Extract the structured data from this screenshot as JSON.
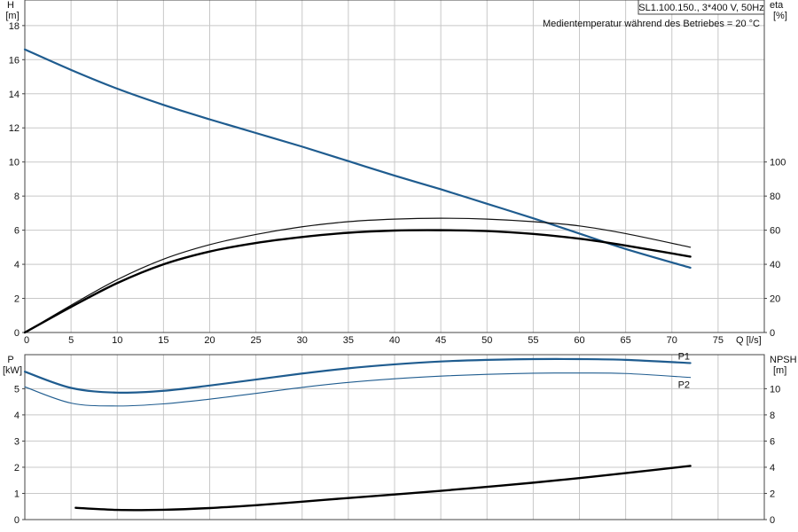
{
  "chart_data": [
    {
      "type": "line",
      "title": "SL1.100.150., 3*400 V, 50Hz",
      "subtitle": "Medientemperatur während des Betriebes = 20 °C",
      "xlabel": "Q [l/s]",
      "ylabel_left": [
        "H",
        "[m]"
      ],
      "ylabel_right": [
        "eta",
        "[%]"
      ],
      "xlim": [
        0,
        80
      ],
      "ylim_left": [
        0,
        19.5
      ],
      "ylim_right": [
        0,
        195
      ],
      "x_ticks": [
        "0",
        "5",
        "10",
        "15",
        "20",
        "25",
        "30",
        "35",
        "40",
        "45",
        "50",
        "55",
        "60",
        "65",
        "70",
        "75"
      ],
      "y_left_ticks": [
        "0",
        "2",
        "4",
        "6",
        "8",
        "10",
        "12",
        "14",
        "16",
        "18"
      ],
      "y_right_ticks": [
        "0",
        "20",
        "40",
        "60",
        "80",
        "100"
      ],
      "grid": true,
      "series": [
        {
          "axis": "left",
          "color": "#1f5c8f",
          "width": 2.2,
          "x": [
            0,
            5,
            10,
            15,
            20,
            25,
            30,
            35,
            40,
            45,
            50,
            55,
            60,
            65,
            72
          ],
          "y": [
            16.6,
            15.4,
            14.3,
            13.35,
            12.5,
            11.7,
            10.9,
            10.05,
            9.2,
            8.4,
            7.55,
            6.7,
            5.8,
            4.9,
            3.8
          ]
        },
        {
          "axis": "right",
          "color": "#111111",
          "width": 1.2,
          "x": [
            0,
            5,
            10,
            15,
            20,
            25,
            30,
            35,
            40,
            45,
            50,
            55,
            60,
            65,
            72
          ],
          "y": [
            0,
            16,
            31,
            43,
            51.5,
            57.5,
            62,
            65,
            66.5,
            67,
            66.5,
            65,
            62.5,
            58,
            50
          ]
        },
        {
          "axis": "right",
          "color": "#000000",
          "width": 2.4,
          "x": [
            0,
            5,
            10,
            15,
            20,
            25,
            30,
            35,
            40,
            45,
            50,
            55,
            60,
            65,
            72
          ],
          "y": [
            0,
            15,
            29,
            40,
            47.5,
            52.5,
            56,
            58.5,
            59.8,
            60,
            59.5,
            57.8,
            55,
            51,
            44.5
          ]
        }
      ]
    },
    {
      "type": "line",
      "ylabel_left": [
        "P",
        "[kW]"
      ],
      "ylabel_right": [
        "NPSH",
        "[m]"
      ],
      "xlim": [
        0,
        80
      ],
      "ylim_left": [
        0,
        6.3
      ],
      "ylim_right": [
        0,
        12.6
      ],
      "y_left_ticks": [
        "0",
        "1",
        "2",
        "3",
        "4",
        "5"
      ],
      "y_right_ticks": [
        "0",
        "2",
        "4",
        "6",
        "8",
        "10"
      ],
      "grid": true,
      "series": [
        {
          "name": "P1",
          "axis": "left",
          "color": "#1f5c8f",
          "width": 2.2,
          "x": [
            0,
            5,
            10,
            15,
            20,
            25,
            30,
            35,
            40,
            45,
            50,
            55,
            60,
            65,
            72
          ],
          "y": [
            5.65,
            5.03,
            4.85,
            4.92,
            5.12,
            5.35,
            5.58,
            5.78,
            5.93,
            6.04,
            6.1,
            6.13,
            6.13,
            6.1,
            5.98
          ]
        },
        {
          "name": "P2",
          "axis": "left",
          "color": "#1f5c8f",
          "width": 1.1,
          "x": [
            0,
            5,
            10,
            15,
            20,
            25,
            30,
            35,
            40,
            45,
            50,
            55,
            60,
            65,
            72
          ],
          "y": [
            5.07,
            4.45,
            4.34,
            4.42,
            4.6,
            4.82,
            5.05,
            5.24,
            5.38,
            5.48,
            5.55,
            5.59,
            5.6,
            5.58,
            5.43
          ]
        },
        {
          "axis": "right",
          "color": "#000000",
          "width": 2.4,
          "x": [
            5.5,
            10,
            15,
            20,
            25,
            30,
            35,
            40,
            45,
            50,
            55,
            60,
            65,
            72
          ],
          "y": [
            0.9,
            0.74,
            0.75,
            0.88,
            1.1,
            1.37,
            1.65,
            1.92,
            2.2,
            2.5,
            2.82,
            3.17,
            3.55,
            4.1
          ]
        }
      ]
    }
  ]
}
